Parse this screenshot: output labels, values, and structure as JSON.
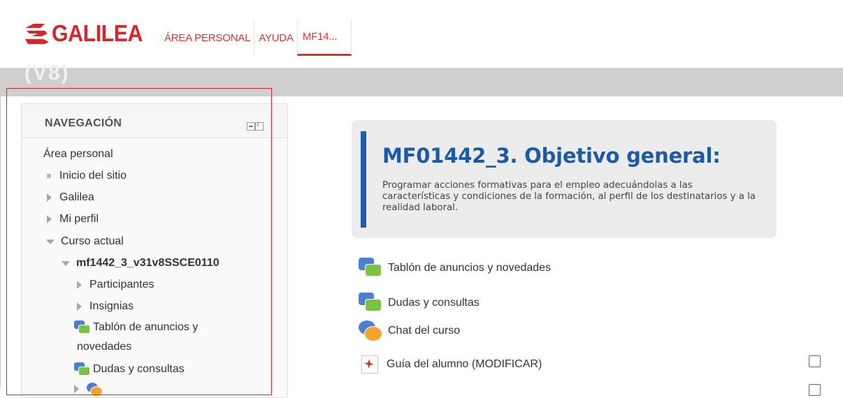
{
  "header": {
    "logo_text": "GALILEA",
    "nav": [
      "ÁREA PERSONAL",
      "AYUDA",
      "MF14..."
    ]
  },
  "banner_fragment": "(V8)",
  "navigation": {
    "title": "NAVEGACIÓN",
    "items": [
      {
        "label": "Área personal"
      },
      {
        "label": "Inicio del sitio"
      },
      {
        "label": "Galilea"
      },
      {
        "label": "Mi perfil"
      },
      {
        "label": "Curso actual"
      },
      {
        "label": "mf1442_3_v31v8SSCE0110"
      },
      {
        "label": "Participantes"
      },
      {
        "label": "Insignias"
      },
      {
        "label": "Tablón de anuncios y"
      },
      {
        "label": "novedades"
      },
      {
        "label": "Dudas y consultas"
      }
    ]
  },
  "main": {
    "objective_title": "MF01442_3. Objetivo general:",
    "objective_text": "Programar acciones formativas para el empleo adecuándolas a las características y condiciones de la formación, al perfil de los destinatarios y a la realidad laboral.",
    "activities": [
      {
        "label": "Tablón de anuncios y novedades",
        "icon": "forum-icon"
      },
      {
        "label": "Dudas y consultas",
        "icon": "forum-icon"
      },
      {
        "label": "Chat del curso",
        "icon": "chat-icon"
      },
      {
        "label": "Guía del alumno (MODIFICAR)",
        "icon": "pdf-icon"
      }
    ]
  },
  "colors": {
    "brand_red": "#e0312b",
    "title_blue": "#1c5aa8",
    "highlight_box": "#e02020"
  }
}
